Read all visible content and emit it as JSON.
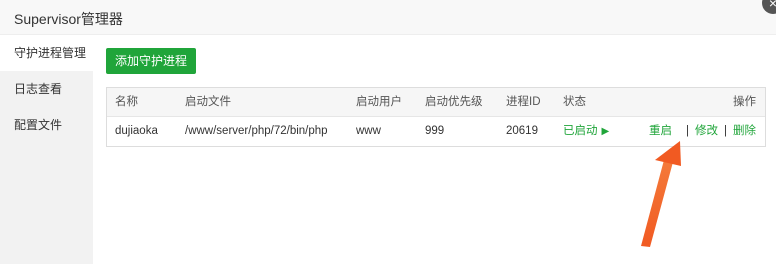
{
  "window": {
    "title": "Supervisor管理器",
    "close_label": "×"
  },
  "sidebar": {
    "items": [
      {
        "label": "守护进程管理",
        "active": true
      },
      {
        "label": "日志查看",
        "active": false
      },
      {
        "label": "配置文件",
        "active": false
      }
    ]
  },
  "toolbar": {
    "add_label": "添加守护进程"
  },
  "table": {
    "headers": {
      "name": "名称",
      "command": "启动文件",
      "user": "启动用户",
      "priority": "启动优先级",
      "pid": "进程ID",
      "status": "状态",
      "actions": "操作"
    },
    "rows": [
      {
        "name": "dujiaoka",
        "command": "/www/server/php/72/bin/php",
        "user": "www",
        "priority": "999",
        "pid": "20619",
        "status": "已启动",
        "status_icon": "play-icon",
        "actions": {
          "restart": "重启",
          "separator": "|",
          "edit": "修改",
          "delete": "删除"
        }
      }
    ]
  },
  "annotation": {
    "arrow_color": "#f15a22",
    "points_to": "restart action"
  },
  "colors": {
    "accent_green": "#20a53a",
    "sidebar_bg": "#f2f2f2",
    "header_bg": "#f6f6f6"
  }
}
